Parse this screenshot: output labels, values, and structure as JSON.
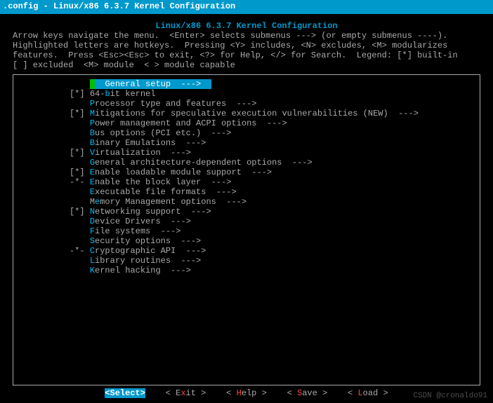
{
  "titlebar": ".config - Linux/x86 6.3.7 Kernel Configuration",
  "inner_title": "Linux/x86 6.3.7 Kernel Configuration",
  "help_lines": [
    "Arrow keys navigate the menu.  <Enter> selects submenus ---> (or empty submenus ----).",
    "Highlighted letters are hotkeys.  Pressing <Y> includes, <N> excludes, <M> modularizes",
    "features.  Press <Esc><Esc> to exit, <?> for Help, </> for Search.  Legend: [*] built-in",
    "[ ] excluded  <M> module  < > module capable"
  ],
  "menu": [
    {
      "mark": "   ",
      "pre": "",
      "hk": "G",
      "rest": "eneral setup  --->",
      "selected": true
    },
    {
      "mark": "[*]",
      "pre": "64-",
      "hk": "b",
      "rest": "it kernel"
    },
    {
      "mark": "   ",
      "pre": "",
      "hk": "P",
      "rest": "rocessor type and features  --->"
    },
    {
      "mark": "[*]",
      "pre": "",
      "hk": "M",
      "rest": "itigations for speculative execution vulnerabilities (NEW)  --->"
    },
    {
      "mark": "   ",
      "pre": "",
      "hk": "P",
      "rest": "ower management and ACPI options  --->"
    },
    {
      "mark": "   ",
      "pre": "",
      "hk": "B",
      "rest": "us options (PCI etc.)  --->"
    },
    {
      "mark": "   ",
      "pre": "",
      "hk": "B",
      "rest": "inary Emulations  --->"
    },
    {
      "mark": "[*]",
      "pre": "",
      "hk": "V",
      "rest": "irtualization  --->"
    },
    {
      "mark": "   ",
      "pre": "",
      "hk": "G",
      "rest": "eneral architecture-dependent options  --->"
    },
    {
      "mark": "[*]",
      "pre": "",
      "hk": "E",
      "rest": "nable loadable module support  --->"
    },
    {
      "mark": "-*-",
      "pre": "",
      "hk": "E",
      "rest": "nable the block layer  --->"
    },
    {
      "mark": "   ",
      "pre": "",
      "hk": "E",
      "rest": "xecutable file formats  --->"
    },
    {
      "mark": "   ",
      "pre": "M",
      "hk": "e",
      "rest": "mory Management options  --->"
    },
    {
      "mark": "[*]",
      "pre": "",
      "hk": "N",
      "rest": "etworking support  --->"
    },
    {
      "mark": "   ",
      "pre": "",
      "hk": "D",
      "rest": "evice Drivers  --->"
    },
    {
      "mark": "   ",
      "pre": "",
      "hk": "F",
      "rest": "ile systems  --->"
    },
    {
      "mark": "   ",
      "pre": "",
      "hk": "S",
      "rest": "ecurity options  --->"
    },
    {
      "mark": "-*-",
      "pre": "",
      "hk": "C",
      "rest": "ryptographic API  --->"
    },
    {
      "mark": "   ",
      "pre": "",
      "hk": "L",
      "rest": "ibrary routines  --->"
    },
    {
      "mark": "   ",
      "pre": "",
      "hk": "K",
      "rest": "ernel hacking  --->"
    }
  ],
  "buttons": {
    "select": "<Select>",
    "exit_pre": "< E",
    "exit_hk": "x",
    "exit_post": "it >",
    "help_pre": "< ",
    "help_hk": "H",
    "help_post": "elp >",
    "save_pre": "< ",
    "save_hk": "S",
    "save_post": "ave >",
    "load_pre": "< ",
    "load_hk": "L",
    "load_post": "oad >"
  },
  "watermark": "CSDN @cronaldo91"
}
